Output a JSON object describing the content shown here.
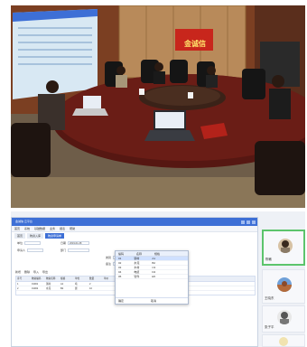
{
  "photo": {
    "alt_label": "meeting-room-photo",
    "logo_text": "金诚信",
    "colors": {
      "wall": "#8a4a2a",
      "table": "#5a1a14",
      "carpet": "#7a6a52",
      "screen": "#cfe4f3"
    }
  },
  "app": {
    "title": "金诚信 云平台",
    "menu": [
      "首页",
      "系统",
      "基础数据",
      "业务",
      "报表",
      "帮助"
    ],
    "tabs": [
      "首页",
      "物资入库",
      "物资申请单"
    ],
    "active_tab": 2,
    "form": {
      "fields": [
        {
          "label": "单位",
          "value": ""
        },
        {
          "label": "日期",
          "value": "2019-01-08"
        },
        {
          "label": "申请人",
          "value": ""
        },
        {
          "label": "部门",
          "value": ""
        },
        {
          "label": "类别",
          "value": "材料"
        },
        {
          "label": "备注",
          "value": ""
        }
      ]
    },
    "dropdown": {
      "headers": [
        "编码",
        "名称",
        "规格"
      ],
      "rows": [
        [
          "01",
          "钢材",
          "A1"
        ],
        [
          "02",
          "水泥",
          "B2"
        ],
        [
          "03",
          "木材",
          "C3"
        ],
        [
          "04",
          "电缆",
          "D4"
        ],
        [
          "05",
          "管件",
          "E5"
        ]
      ],
      "selected_row": 0,
      "footer": [
        "确定",
        "取消"
      ]
    },
    "grid": {
      "toolbar": [
        "新增",
        "删除",
        "导入",
        "导出"
      ],
      "columns": [
        "序号",
        "物资编码",
        "物资名称",
        "规格",
        "单位",
        "数量",
        "单价",
        "金额",
        "备注"
      ],
      "rows": [
        [
          "1",
          "01001",
          "钢材",
          "A1",
          "吨",
          "2",
          "",
          "",
          ""
        ],
        [
          "2",
          "01002",
          "水泥",
          "B2",
          "袋",
          "10",
          "",
          "",
          ""
        ]
      ]
    }
  },
  "participants": [
    {
      "name": "陈敏",
      "active": true
    },
    {
      "name": "王晓东",
      "active": false
    },
    {
      "name": "张子平",
      "active": false
    },
    {
      "name": "",
      "active": false
    }
  ]
}
